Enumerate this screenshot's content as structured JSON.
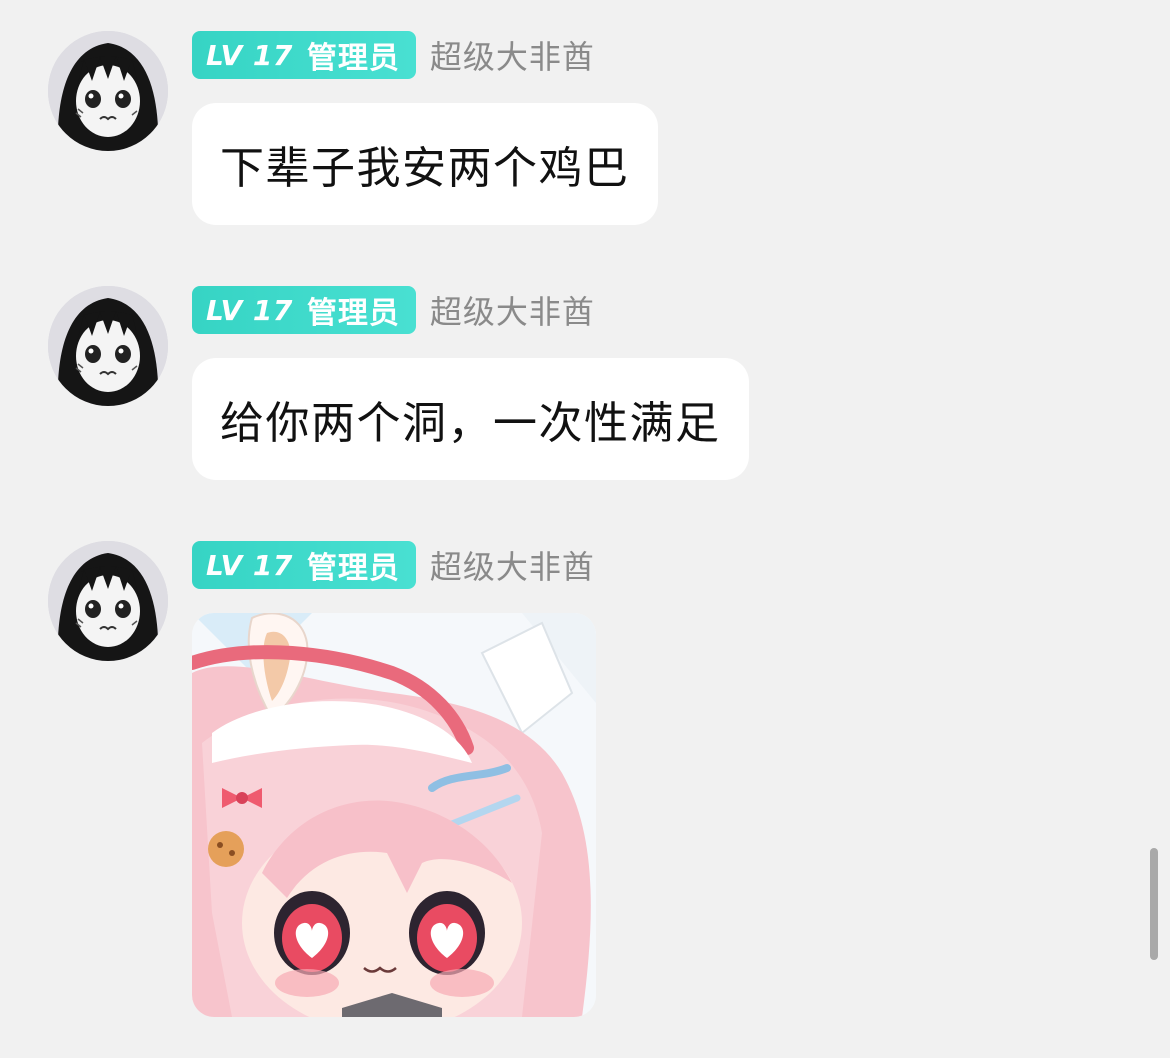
{
  "chat": {
    "messages": [
      {
        "avatar_icon": "anime-girl-avatar",
        "level": "LV 17",
        "role": "管理员",
        "username": "超级大非酋",
        "content_type": "text",
        "text": "下辈子我安两个鸡巴"
      },
      {
        "avatar_icon": "anime-girl-avatar",
        "level": "LV 17",
        "role": "管理员",
        "username": "超级大非酋",
        "content_type": "text",
        "text": "给你两个洞，一次性满足"
      },
      {
        "avatar_icon": "anime-girl-avatar",
        "level": "LV 17",
        "role": "管理员",
        "username": "超级大非酋",
        "content_type": "image",
        "image_icon": "pink-anime-girl-sticker"
      }
    ]
  },
  "colors": {
    "background": "#f1f1f1",
    "badge": "#3fd9cb",
    "bubble": "#ffffff",
    "username": "#8a8a8a"
  }
}
